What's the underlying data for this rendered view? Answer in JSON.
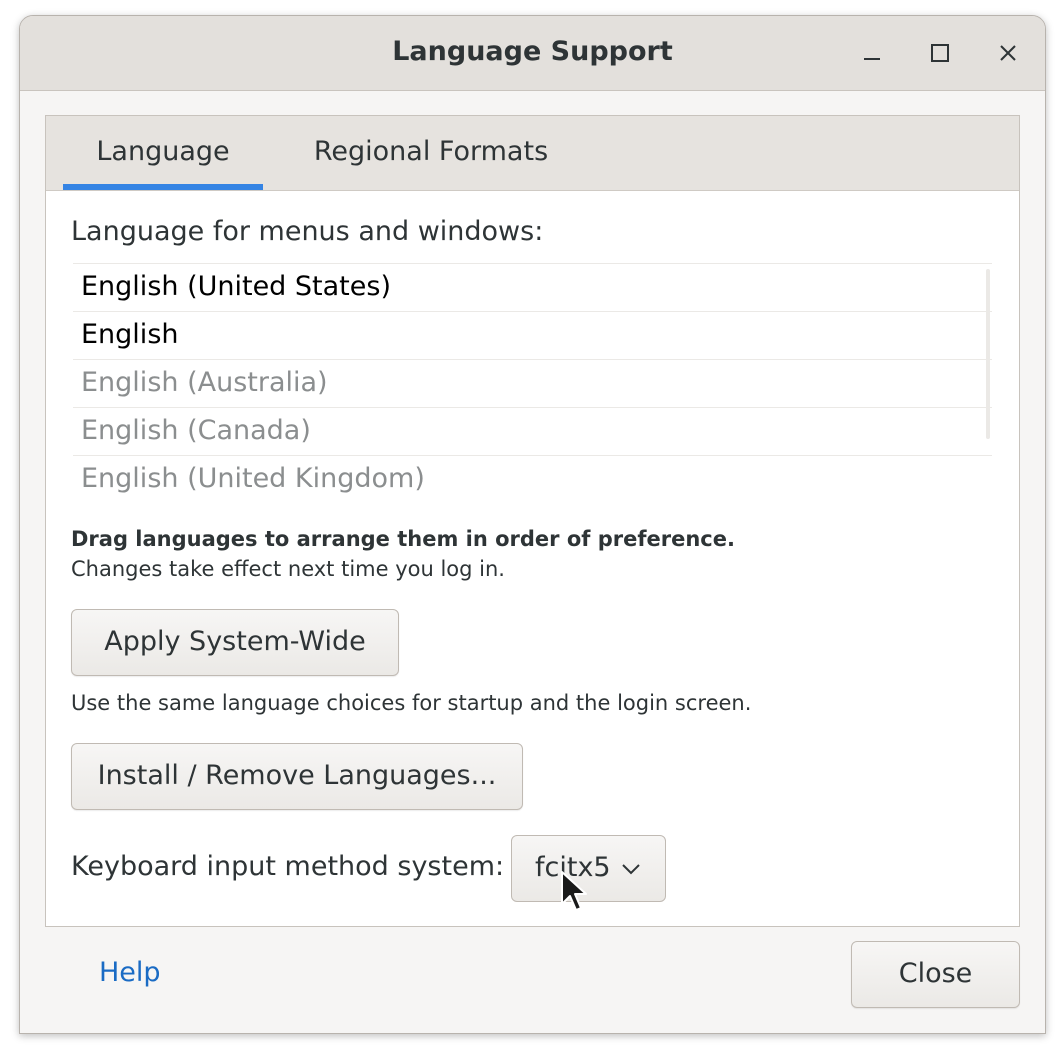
{
  "window": {
    "title": "Language Support"
  },
  "tabs": [
    {
      "label": "Language",
      "active": true
    },
    {
      "label": "Regional Formats",
      "active": false
    }
  ],
  "language_tab": {
    "section_label": "Language for menus and windows:",
    "languages": [
      {
        "label": "English (United States)",
        "enabled": true
      },
      {
        "label": "English",
        "enabled": true
      },
      {
        "label": "English (Australia)",
        "enabled": false
      },
      {
        "label": "English (Canada)",
        "enabled": false
      },
      {
        "label": "English (United Kingdom)",
        "enabled": false
      }
    ],
    "drag_hint": "Drag languages to arrange them in order of preference.",
    "changes_hint": "Changes take effect next time you log in.",
    "apply_button": "Apply System-Wide",
    "apply_description": "Use the same language choices for startup and the login screen.",
    "install_button": "Install / Remove Languages...",
    "keyboard_label": "Keyboard input method system:",
    "keyboard_value": "fcitx5"
  },
  "footer": {
    "help_link": "Help",
    "close_button": "Close"
  },
  "icons": {
    "minimize": "minimize-icon",
    "maximize": "maximize-icon",
    "close": "close-icon",
    "dropdown": "chevron-down-icon",
    "cursor": "mouse-pointer-icon"
  },
  "colors": {
    "accent": "#3584e4",
    "link": "#1a6bc4",
    "disabled_text": "#8b8e8f"
  }
}
